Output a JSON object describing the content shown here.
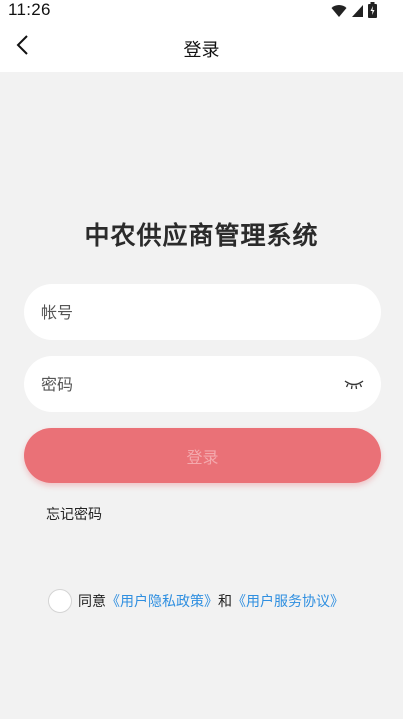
{
  "status_bar": {
    "time": "11:26",
    "icons": [
      "wifi-icon",
      "signal-icon",
      "battery-icon"
    ]
  },
  "nav": {
    "title": "登录",
    "back_icon": "chevron-left-icon"
  },
  "app_title": "中农供应商管理系统",
  "form": {
    "account_placeholder": "帐号",
    "account_value": "",
    "password_placeholder": "密码",
    "password_value": "",
    "password_toggle_icon": "eye-closed-icon",
    "login_label": "登录",
    "forgot_label": "忘记密码"
  },
  "agreement": {
    "prefix": "同意",
    "privacy_link": "《用户隐私政策》",
    "conjunction": "和",
    "service_link": "《用户服务协议》",
    "checked": false
  },
  "colors": {
    "page_bg": "#f2f2f2",
    "login_button": "#ea7177",
    "login_text": "#f4a9ad",
    "link": "#2f8fe0"
  }
}
